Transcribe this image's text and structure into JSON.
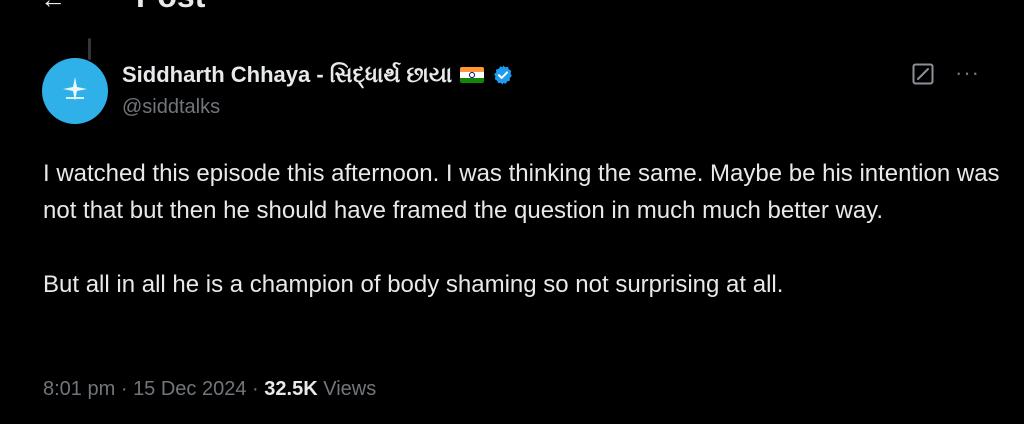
{
  "header": {
    "title": "Post"
  },
  "author": {
    "display_name": "Siddharth Chhaya - સિદ્ધાર્થ છાયા",
    "handle": "@siddtalks",
    "flag_icon": "india-flag-icon",
    "verified_icon": "verified-badge-icon",
    "verified_color": "#1d9bf0",
    "avatar_color": "#2fb0e8"
  },
  "tweet": {
    "paragraphs": [
      "I watched this episode this afternoon. I was thinking the same. Maybe be his intention was not that but then he should have framed the question in much much better way.",
      "But all in all he is a champion of body shaming so not surprising at all."
    ],
    "time": "8:01 pm",
    "separator": "·",
    "date": "15 Dec 2024",
    "views_count": "32.5K",
    "views_label": "Views"
  },
  "actions": {
    "edit_icon": "edit-icon",
    "more_icon": "more-icon"
  }
}
